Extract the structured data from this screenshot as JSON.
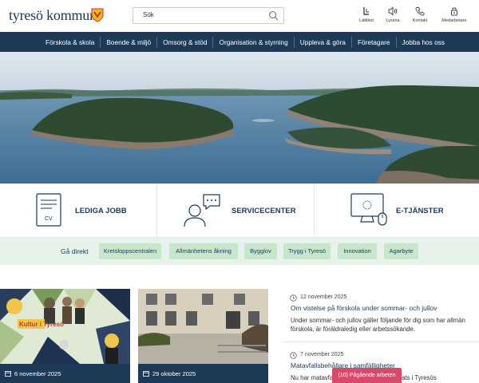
{
  "header": {
    "logo_text": "tyresö kommun",
    "search": {
      "placeholder": "Sök"
    },
    "tools": [
      {
        "label": "Lättläst",
        "icon": "easy-read-icon"
      },
      {
        "label": "Lyssna",
        "icon": "speaker-icon"
      },
      {
        "label": "Kontakt",
        "icon": "phone-icon"
      },
      {
        "label": "Medarbetare",
        "icon": "lock-icon"
      }
    ]
  },
  "nav": {
    "items": [
      "Förskola & skola",
      "Boende & miljö",
      "Omsorg & stöd",
      "Organisation & styrning",
      "Uppleva & göra",
      "Företagare",
      "Jobba hos oss"
    ]
  },
  "quick_links": [
    {
      "label": "LEDIGA JOBB",
      "icon": "cv-document-icon"
    },
    {
      "label": "SERVICECENTER",
      "icon": "person-chat-icon"
    },
    {
      "label": "E-TJÄNSTER",
      "icon": "computer-mouse-icon"
    }
  ],
  "direct": {
    "label": "Gå direkt",
    "chips": [
      "Kretsloppscentralen",
      "Allmänhetens åkning",
      "Bygglov",
      "Trygg i Tyresö",
      "Innovation",
      "Agarbyte"
    ]
  },
  "news_cards": [
    {
      "date": "6 november 2025",
      "image_caption": "Kultur i Tyresö"
    },
    {
      "date": "29 oktober 2025"
    }
  ],
  "news_list": [
    {
      "date": "12 november 2025",
      "title": "Om vistelse på förskola under sommar- och jullov",
      "body": "Under sommar- och jullov gäller följande för dig som har allmän förskola, är föräldraledig eller arbetssökande."
    },
    {
      "date": "7 november 2025",
      "title": "Matavfallsbehållare i samfälligheter",
      "body": "Nu har matavfallsbehållare kommit på plats i Tyresös"
    }
  ],
  "pending_button": "(10) Pågående arbeten",
  "colors": {
    "navy": "#1d3a57",
    "green_band": "#e7f3ea",
    "chip": "#c6e7cc",
    "alert": "#d94a6a"
  }
}
